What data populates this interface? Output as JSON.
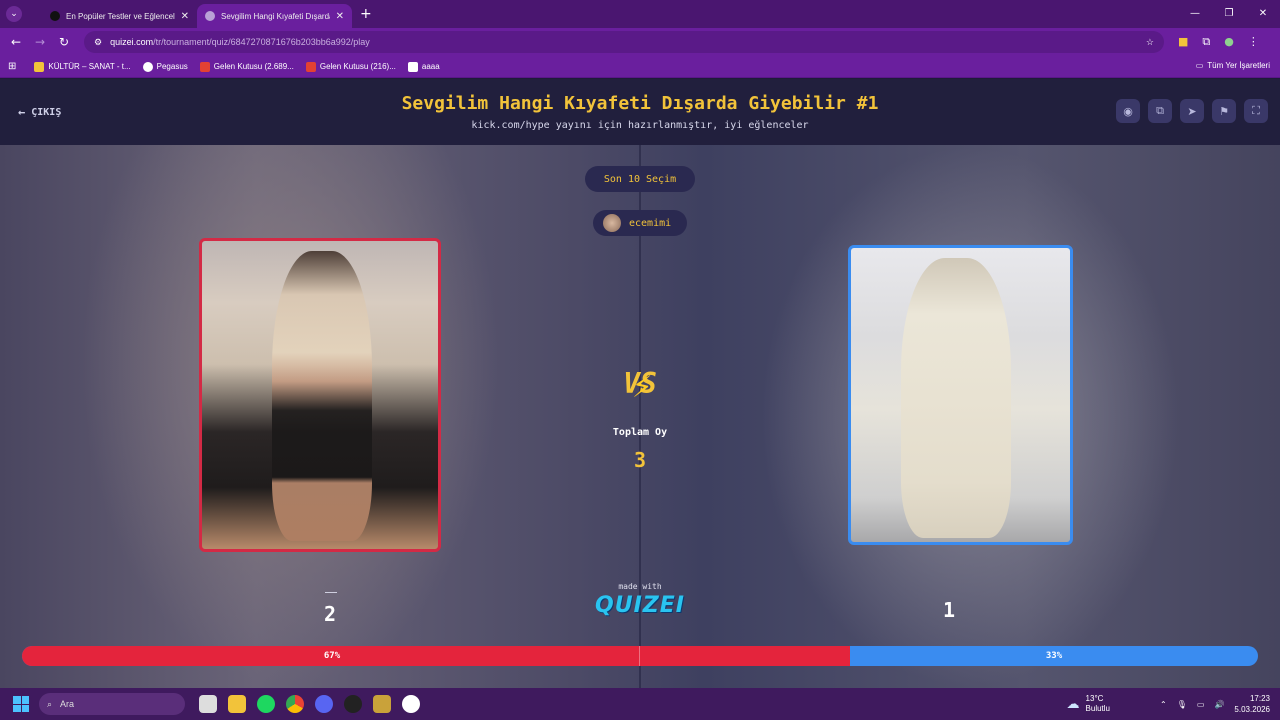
{
  "browser": {
    "tabs": [
      {
        "title": "En Popüler Testler ve Eğlenceli",
        "active": false
      },
      {
        "title": "Sevgilim Hangi Kıyafeti Dışarda",
        "active": true
      }
    ],
    "url_domain": "quizei.com",
    "url_path": "/tr/tournament/quiz/6847270871676b203bb6a992/play",
    "bookmarks": [
      "KÜLTÜR – SANAT - t...",
      "Pegasus",
      "Gelen Kutusu (2.689...",
      "Gelen Kutusu (216)...",
      "aaaa"
    ],
    "all_bookmarks": "Tüm Yer İşaretleri"
  },
  "header": {
    "exit_label": "ÇIKIŞ",
    "title": "Sevgilim Hangi Kıyafeti Dışarda Giyebilir #1",
    "subtitle": "kick.com/hype yayını için hazırlanmıştır, iyi eğlenceler",
    "icons": [
      "eye-icon",
      "share-icon",
      "send-icon",
      "flag-icon",
      "fullscreen-icon"
    ]
  },
  "game": {
    "last_choices_label": "Son 10 Seçim",
    "username": "ecemimi",
    "vs_label": "VS",
    "total_votes_label": "Toplam Oy",
    "total_votes": "3",
    "left_count": "2",
    "right_count": "1",
    "left_percent": "67%",
    "right_percent": "33%",
    "left_share": 0.67,
    "made_with": "made with",
    "logo_text": "QUIZEI",
    "colors": {
      "left": "#e4243c",
      "right": "#3a8cf0",
      "accent": "#f2c33a"
    }
  },
  "taskbar": {
    "search_placeholder": "Ara",
    "weather_temp": "13°C",
    "weather_desc": "Bulutlu",
    "time": "17:23",
    "date": "5.03.2026"
  }
}
